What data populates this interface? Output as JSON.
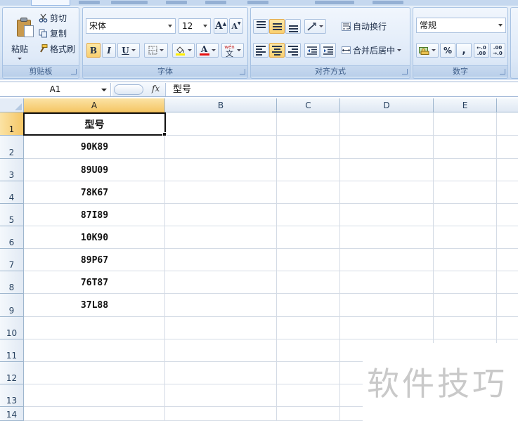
{
  "ribbon": {
    "clipboard": {
      "paste": "粘贴",
      "cut": "剪切",
      "copy": "复制",
      "format_painter": "格式刷",
      "label": "剪贴板"
    },
    "font": {
      "name": "宋体",
      "size": "12",
      "grow": "A",
      "shrink": "A",
      "bold": "B",
      "italic": "I",
      "underline": "U",
      "font_color_glyph": "A",
      "phonetic_top": "wén",
      "phonetic_glyph": "文",
      "label": "字体"
    },
    "alignment": {
      "wrap_text": "自动换行",
      "merge_center": "合并后居中",
      "label": "对齐方式"
    },
    "number": {
      "format": "常规",
      "percent": "%",
      "comma": ",",
      "inc_decimal_top": "←.0",
      "inc_decimal_bottom": ".00",
      "dec_decimal_top": ".00",
      "dec_decimal_bottom": "→.0",
      "label": "数字"
    }
  },
  "formula_bar": {
    "name_box": "A1",
    "fx": "fx",
    "content": "型号"
  },
  "grid": {
    "columns": [
      "A",
      "B",
      "C",
      "D",
      "E"
    ],
    "rows": [
      "1",
      "2",
      "3",
      "4",
      "5",
      "6",
      "7",
      "8",
      "9",
      "10",
      "11",
      "12",
      "13",
      "14"
    ],
    "column_a": [
      "型号",
      "90K89",
      "89U09",
      "78K67",
      "87I89",
      "10K90",
      "89P67",
      "76T87",
      "37L88"
    ]
  },
  "watermark": "软件技巧",
  "colors": {
    "selected_header": "#f5c665",
    "ribbon_bg": "#dfeaf8",
    "grid_line": "#d4dbe5",
    "font_color_bar": "#e81010",
    "highlight_bar": "#ffee00"
  }
}
